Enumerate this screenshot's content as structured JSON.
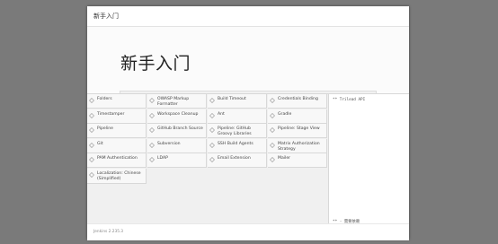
{
  "dialog": {
    "title": "新手入门",
    "hero_title": "新手入门",
    "progress": 0.0
  },
  "plugins": [
    {
      "name": "Folders"
    },
    {
      "name": "OWASP Markup Formatter"
    },
    {
      "name": "Build Timeout"
    },
    {
      "name": "Credentials Binding"
    },
    {
      "name": "Timestamper"
    },
    {
      "name": "Workspace Cleanup"
    },
    {
      "name": "Ant"
    },
    {
      "name": "Gradle"
    },
    {
      "name": "Pipeline"
    },
    {
      "name": "GitHub Branch Source"
    },
    {
      "name": "Pipeline: GitHub Groovy Libraries"
    },
    {
      "name": "Pipeline: Stage View"
    },
    {
      "name": "Git"
    },
    {
      "name": "Subversion"
    },
    {
      "name": "SSH Build Agents"
    },
    {
      "name": "Matrix Authorization Strategy"
    },
    {
      "name": "PAM Authentication"
    },
    {
      "name": "LDAP"
    },
    {
      "name": "Email Extension"
    },
    {
      "name": "Mailer"
    },
    {
      "name": "Localization: Chinese (Simplified)"
    }
  ],
  "log": {
    "line1": "** Trilead API",
    "line2": "** - 需要依赖"
  },
  "footer": {
    "version": "Jenkins 2.235.3"
  },
  "icons": {
    "plugin": "status-icon"
  }
}
